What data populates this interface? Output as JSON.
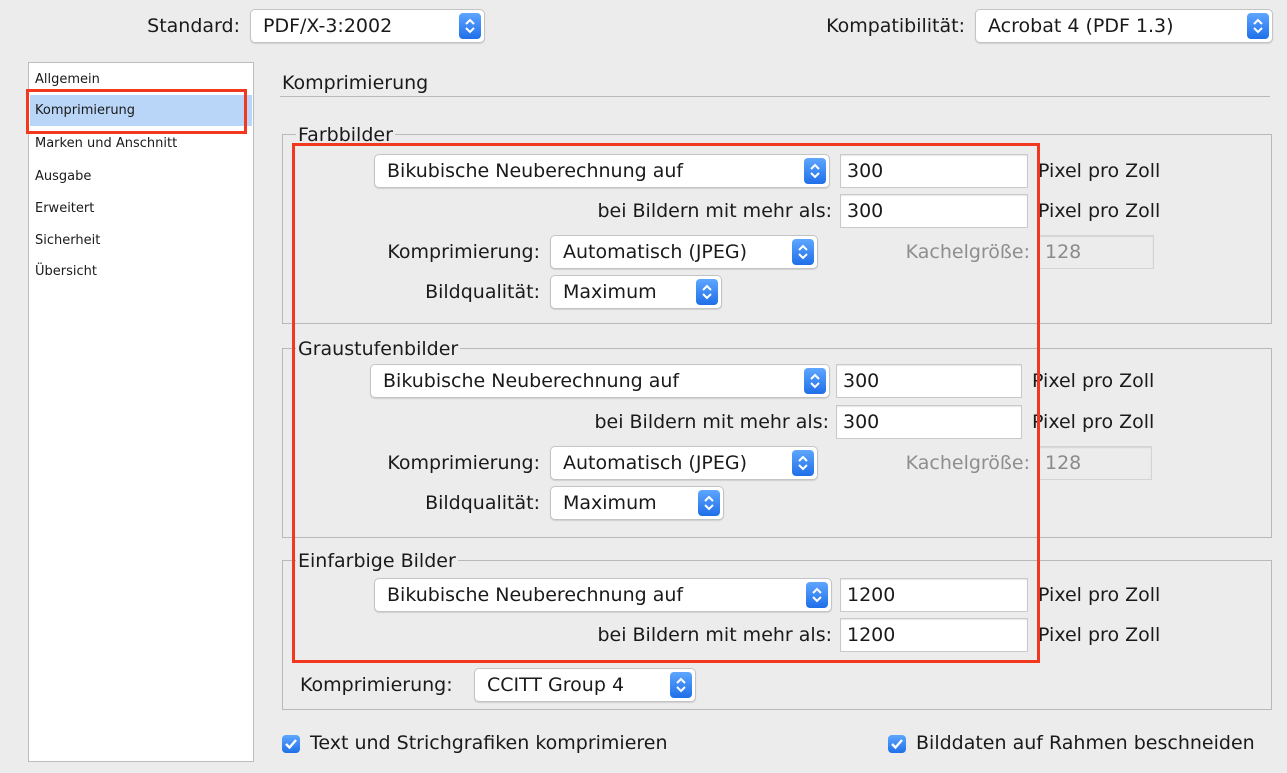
{
  "top": {
    "standard_label": "Standard:",
    "standard_value": "PDF/X-3:2002",
    "compat_label": "Kompatibilität:",
    "compat_value": "Acrobat 4 (PDF 1.3)"
  },
  "sidebar": {
    "items": [
      {
        "label": "Allgemein"
      },
      {
        "label": "Komprimierung",
        "selected": true
      },
      {
        "label": "Marken und Anschnitt"
      },
      {
        "label": "Ausgabe"
      },
      {
        "label": "Erweitert"
      },
      {
        "label": "Sicherheit"
      },
      {
        "label": "Übersicht"
      }
    ]
  },
  "main": {
    "section_title": "Komprimierung",
    "color": {
      "title": "Farbbilder",
      "resample": "Bikubische Neuberechnung auf",
      "ppi": "300",
      "unit": "Pixel pro Zoll",
      "above_label": "bei Bildern mit mehr als:",
      "above_value": "300",
      "unit2": "Pixel pro Zoll",
      "compression_label": "Komprimierung:",
      "compression": "Automatisch (JPEG)",
      "tile_label": "Kachelgröße:",
      "tile_value": "128",
      "quality_label": "Bildqualität:",
      "quality": "Maximum"
    },
    "gray": {
      "title": "Graustufenbilder",
      "resample": "Bikubische Neuberechnung auf",
      "ppi": "300",
      "unit": "Pixel pro Zoll",
      "above_label": "bei Bildern mit mehr als:",
      "above_value": "300",
      "unit2": "Pixel pro Zoll",
      "compression_label": "Komprimierung:",
      "compression": "Automatisch (JPEG)",
      "tile_label": "Kachelgröße:",
      "tile_value": "128",
      "quality_label": "Bildqualität:",
      "quality": "Maximum"
    },
    "mono": {
      "title": "Einfarbige Bilder",
      "resample": "Bikubische Neuberechnung auf",
      "ppi": "1200",
      "unit": "Pixel pro Zoll",
      "above_label": "bei Bildern mit mehr als:",
      "above_value": "1200",
      "unit2": "Pixel pro Zoll",
      "compression_label": "Komprimierung:",
      "compression": "CCITT Group 4"
    },
    "checkboxes": {
      "compress_text": "Text und Strichgrafiken komprimieren",
      "crop_images": "Bilddaten auf Rahmen beschneiden"
    }
  },
  "colors": {
    "accent": "#1f6fe8",
    "highlight_box": "#f2381f",
    "sidebar_selected": "#b9d5f7"
  }
}
